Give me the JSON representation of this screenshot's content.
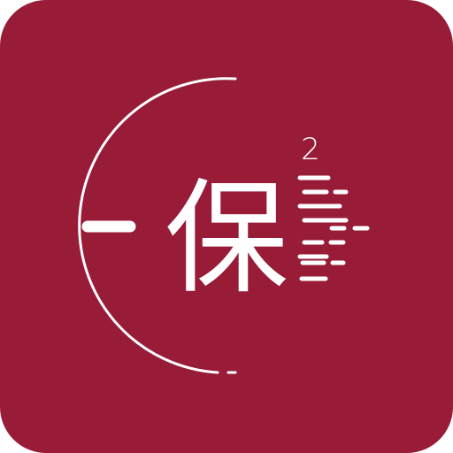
{
  "icon": {
    "character": "保",
    "superscript": "2",
    "background_color": "#981c38",
    "foreground_color": "#ffffff",
    "motif": "half-circle-with-speed-lines"
  }
}
